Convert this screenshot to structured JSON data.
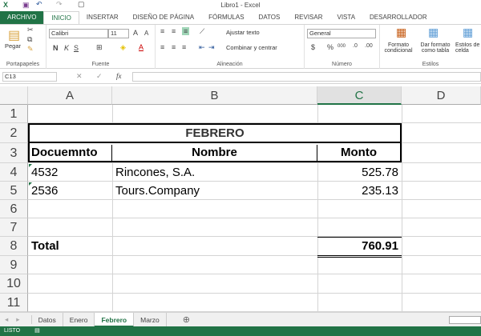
{
  "window": {
    "title": "Libro1 - Excel"
  },
  "ribbon_tabs": [
    "ARCHIVO",
    "INICIO",
    "INSERTAR",
    "DISEÑO DE PÁGINA",
    "FÓRMULAS",
    "DATOS",
    "REVISAR",
    "VISTA",
    "DESARROLLADOR"
  ],
  "ribbon": {
    "clipboard": {
      "paste": "Pegar",
      "label": "Portapapeles"
    },
    "font": {
      "name": "Calibri",
      "size": "11",
      "bold": "N",
      "italic": "K",
      "underline": "S",
      "label": "Fuente"
    },
    "alignment": {
      "wrap": "Ajustar texto",
      "merge": "Combinar y centrar",
      "label": "Alineación"
    },
    "number": {
      "format": "General",
      "currency": "$",
      "percent": "%",
      "thousands": "000",
      "label": "Número"
    },
    "styles": {
      "conditional": "Formato condicional",
      "table": "Dar formato como tabla",
      "cell": "Estilos de celda",
      "label": "Estilos"
    }
  },
  "formula_bar": {
    "name_box": "C13",
    "fx": "fx",
    "value": ""
  },
  "columns": [
    "A",
    "B",
    "C",
    "D"
  ],
  "rows": [
    "1",
    "2",
    "3",
    "4",
    "5",
    "6",
    "7",
    "8",
    "9",
    "10",
    "11"
  ],
  "cells": {
    "title": "FEBRERO",
    "headers": [
      "Docuemnto",
      "Nombre",
      "Monto"
    ],
    "data": [
      [
        "4532",
        "Rincones, S.A.",
        "525.78"
      ],
      [
        "2536",
        "Tours.Company",
        "235.13"
      ]
    ],
    "total_label": "Total",
    "total_value": "760.91"
  },
  "sheet_tabs": [
    "Datos",
    "Enero",
    "Febrero",
    "Marzo"
  ],
  "active_sheet": "Febrero",
  "status": "LISTO",
  "colors": {
    "accent": "#217346"
  }
}
